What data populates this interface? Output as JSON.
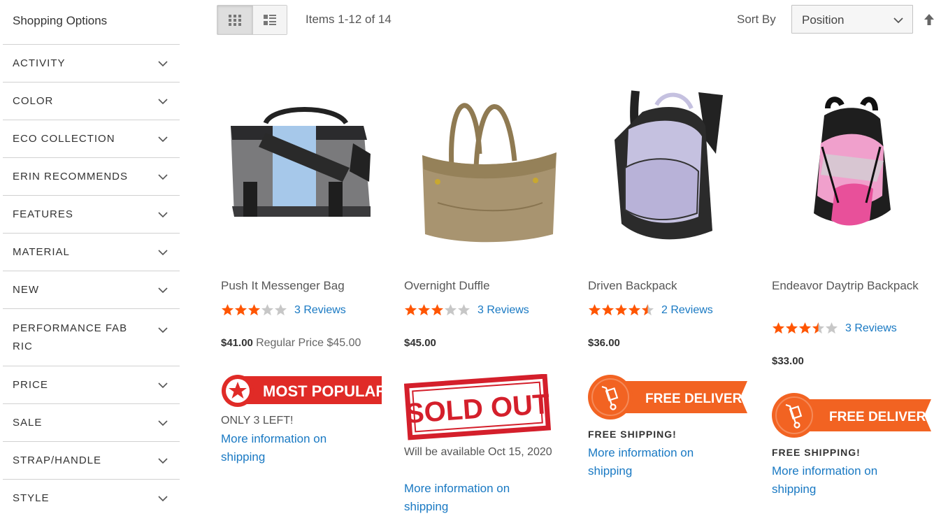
{
  "sidebar": {
    "title": "Shopping Options",
    "filters": [
      {
        "label": "ACTIVITY"
      },
      {
        "label": "COLOR"
      },
      {
        "label": "ECO COLLECTION"
      },
      {
        "label": "ERIN RECOMMENDS"
      },
      {
        "label": "FEATURES"
      },
      {
        "label": "MATERIAL"
      },
      {
        "label": "NEW"
      },
      {
        "label": "PERFORMANCE FAB RIC"
      },
      {
        "label": "PRICE"
      },
      {
        "label": "SALE"
      },
      {
        "label": "STRAP/HANDLE"
      },
      {
        "label": "STYLE"
      }
    ]
  },
  "toolbar": {
    "amount": "Items 1-12 of 14",
    "sort_label": "Sort By",
    "sort_value": "Position",
    "view_modes": [
      "grid-icon",
      "list-icon"
    ]
  },
  "products": [
    {
      "name": "Push It Messenger Bag",
      "rating": 3,
      "reviews": "3 Reviews",
      "price": "$41.00",
      "regular_price": "Regular Price $45.00",
      "badge": "MOST POPULAR",
      "note": "ONLY 3 LEFT!",
      "more": "More information on shipping"
    },
    {
      "name": "Overnight Duffle",
      "rating": 3,
      "reviews": "3 Reviews",
      "price": "$45.00",
      "badge": "SOLD OUT",
      "note": "Will be available Oct 15, 2020",
      "more": "More information on shipping"
    },
    {
      "name": "Driven Backpack",
      "rating": 4.5,
      "reviews": "2 Reviews",
      "price": "$36.00",
      "badge": "FREE DELIVERY",
      "note": "FREE SHIPPING!",
      "more": "More information on shipping"
    },
    {
      "name": "Endeavor Daytrip Backpack",
      "rating": 3.5,
      "reviews": "3 Reviews",
      "price": "$33.00",
      "badge": "FREE DELIVERY",
      "note": "FREE SHIPPING!",
      "more": "More information on shipping"
    }
  ],
  "colors": {
    "star": "#ff5501",
    "star_empty": "#c7c7c7",
    "link": "#1979c3",
    "popular": "#e02b27",
    "delivery": "#f26322"
  }
}
